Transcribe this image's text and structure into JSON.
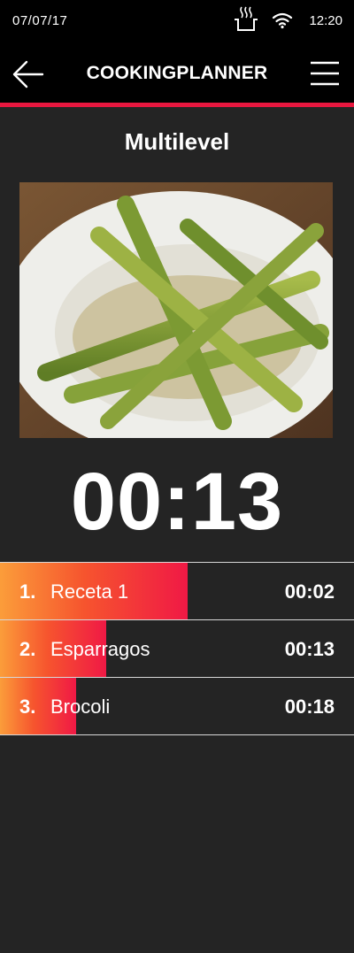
{
  "status": {
    "date": "07/07/17",
    "time": "12:20"
  },
  "header": {
    "title": "COOKINGPLANNER"
  },
  "page": {
    "title": "Multilevel",
    "image_alt": "Esparragos"
  },
  "timer": {
    "value": "00:13"
  },
  "recipes": [
    {
      "number": "1.",
      "name": "Receta 1",
      "time": "00:02",
      "progress": 0.53
    },
    {
      "number": "2.",
      "name": "Esparragos",
      "time": "00:13",
      "progress": 0.3
    },
    {
      "number": "3.",
      "name": "Brocoli",
      "time": "00:18",
      "progress": 0.215
    }
  ],
  "colors": {
    "accent": "#e8173f",
    "progress_start": "#fb9d3a",
    "progress_end": "#f01945"
  },
  "icons": {
    "oven": "oven-steam-icon",
    "wifi": "wifi-icon",
    "back": "back-arrow-icon",
    "menu": "hamburger-menu-icon"
  }
}
